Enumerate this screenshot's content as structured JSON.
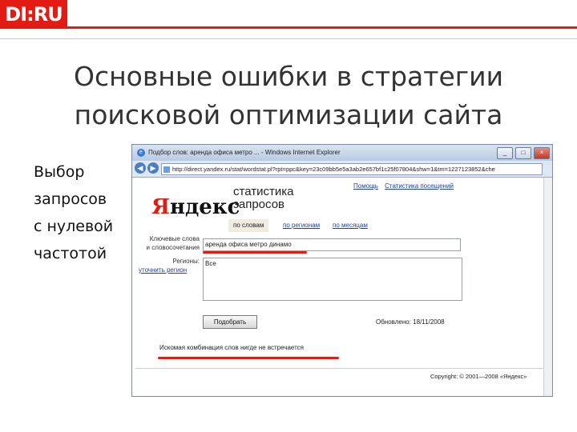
{
  "logo": "DI:RU",
  "slide": {
    "title_line1": "Основные ошибки в стратегии",
    "title_line2": "поисковой оптимизации сайта",
    "bullet": "Выбор\nзапросов\nс нулевой\nчастотой"
  },
  "browser": {
    "title": "Подбор слов: аренда офиса метро ... - Windows Internet Explorer",
    "url": "http://direct.yandex.ru/stat/wordstat.pl?rpt=ppc&key=23c09bb5e5a3ab2e657bf1c25f07804&shw=1&tm=1227123852&che",
    "window_buttons": [
      "_",
      "□",
      "×"
    ]
  },
  "yandex": {
    "logo_first": "Я",
    "logo_rest": "ндекс",
    "stats_line1": "статистика",
    "stats_line2": "запросов",
    "top_links": [
      "Помощь",
      "Статистика посещений"
    ],
    "tabs": [
      "по словам",
      "по регионам",
      "по месяцам"
    ],
    "keywords_label_1": "Ключевые слова",
    "keywords_label_2": "и словосочетания",
    "keywords_value": "аренда офиса метро динамо",
    "regions_label": "Регионы:",
    "regions_link": "уточнить регион",
    "regions_value": "Все",
    "submit_button": "Подобрать",
    "updated": "Обновлено: 18/11/2008",
    "message": "Искомая комбинация слов нигде не встречается",
    "copyright": "Copyright: © 2001—2008 «Яндекс»"
  }
}
